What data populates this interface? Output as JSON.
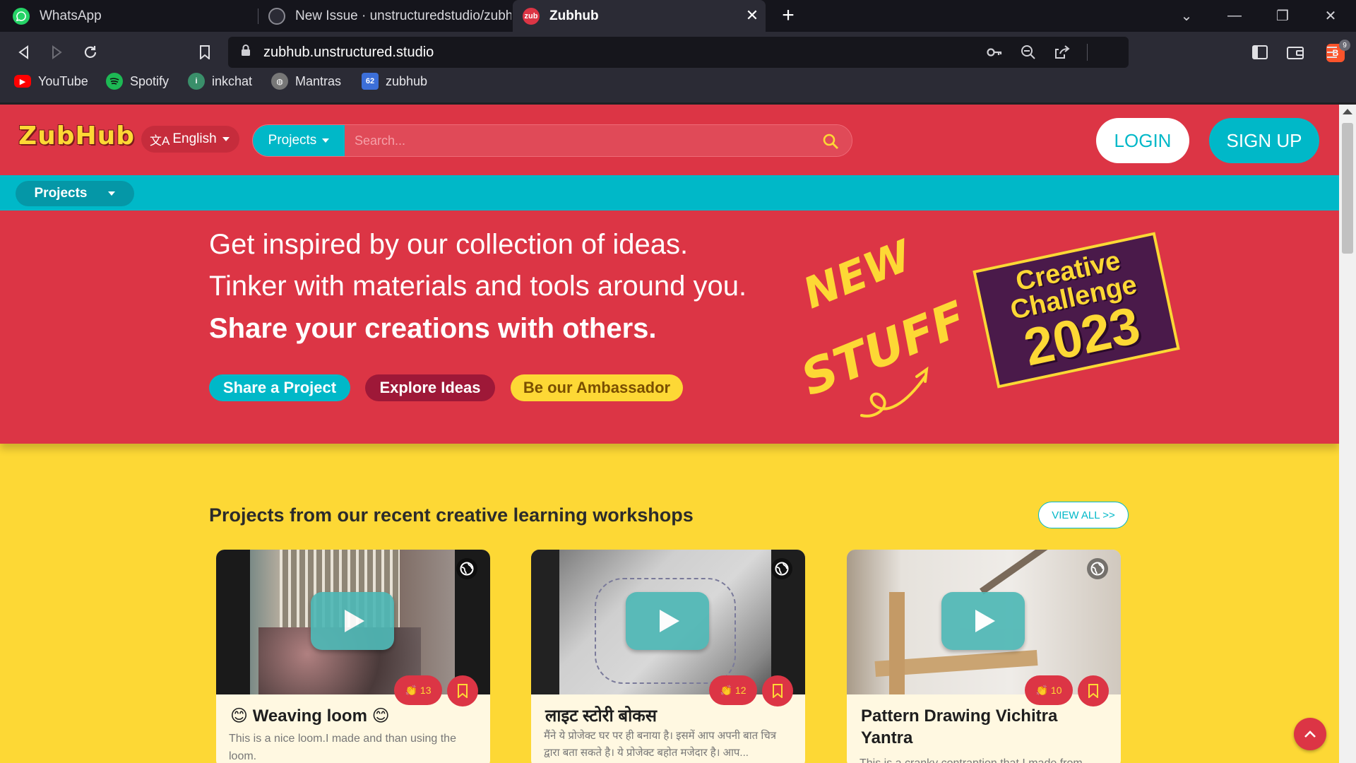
{
  "browser": {
    "tabs": [
      {
        "title": "WhatsApp",
        "icon": "whatsapp-icon"
      },
      {
        "title": "New Issue · unstructuredstudio/zubhub",
        "icon": "github-icon"
      },
      {
        "title": "Zubhub",
        "icon": "zubhub-icon",
        "favicon_text": "zub",
        "active": true
      }
    ],
    "url": "zubhub.unstructured.studio",
    "brave_badge": "9",
    "bookmarks": [
      {
        "label": "YouTube",
        "icon": "youtube-icon",
        "color": "#ff0000"
      },
      {
        "label": "Spotify",
        "icon": "spotify-icon",
        "color": "#1db954"
      },
      {
        "label": "inkchat",
        "icon": "inkchat-icon",
        "color": "#3a8f6a"
      },
      {
        "label": "Mantras",
        "icon": "globe-icon",
        "color": "#777"
      },
      {
        "label": "zubhub",
        "icon": "zubhub-bookmark-icon",
        "color": "#3c6fd8",
        "icon_text": "62"
      }
    ]
  },
  "site": {
    "logo": "ZubHub",
    "language": "English",
    "search": {
      "category": "Projects",
      "placeholder": "Search..."
    },
    "login": "LOGIN",
    "signup": "SIGN UP",
    "subnav_projects": "Projects",
    "colors": {
      "red": "#dc3545",
      "teal": "#00b8c8",
      "yellow": "#fdd835"
    }
  },
  "hero": {
    "line1": "Get inspired by our collection of ideas.",
    "line2": "Tinker with materials and tools around you.",
    "line3": "Share your creations with others.",
    "buttons": {
      "share": "Share a Project",
      "explore": "Explore Ideas",
      "ambassador": "Be our Ambassador"
    },
    "new_stuff": [
      "NEW",
      "STUFF!"
    ],
    "challenge": {
      "line1": "Creative",
      "line2": "Challenge",
      "year": "2023"
    }
  },
  "section": {
    "title": "Projects from our recent creative learning workshops",
    "view_all": "VIEW ALL >>"
  },
  "cards": [
    {
      "title": "😊 Weaving loom 😊",
      "desc": "This is a nice loom.I made and than using the loom.",
      "claps": "13"
    },
    {
      "title": "लाइट स्टोरी बोकस",
      "desc": "मैंने ये प्रोजेक्ट घर पर ही बनाया है। इसमें आप अपनी बात चित्र द्वारा बता सकते है। ये प्रोजेक्ट बहोत मजेदार है। आप...",
      "claps": "12"
    },
    {
      "title": "Pattern Drawing Vichitra Yantra",
      "desc": "This is a cranky contraption that I made from",
      "claps": "10"
    }
  ]
}
